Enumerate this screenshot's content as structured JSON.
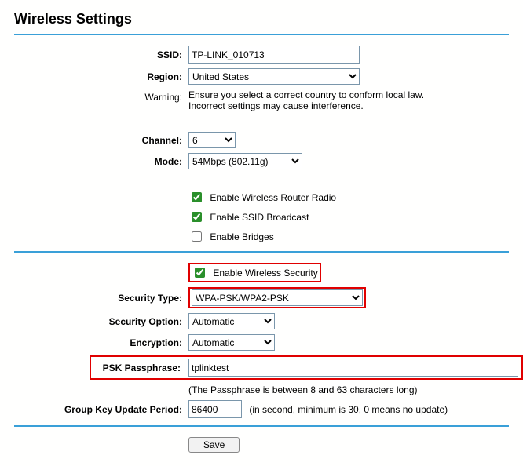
{
  "title": "Wireless Settings",
  "labels": {
    "ssid": "SSID:",
    "region": "Region:",
    "warning": "Warning:",
    "channel": "Channel:",
    "mode": "Mode:",
    "securityType": "Security Type:",
    "securityOption": "Security Option:",
    "encryption": "Encryption:",
    "pskPassphrase": "PSK Passphrase:",
    "groupKeyUpdate": "Group Key Update Period:"
  },
  "values": {
    "ssid": "TP-LINK_010713",
    "region": "United States",
    "channel": "6",
    "mode": "54Mbps (802.11g)",
    "securityType": "WPA-PSK/WPA2-PSK",
    "securityOption": "Automatic",
    "encryption": "Automatic",
    "pskPassphrase": "tplinktest",
    "groupKeyUpdate": "86400"
  },
  "warningText": "Ensure you select a correct country to conform local law. Incorrect settings may cause interference.",
  "checkboxes": {
    "enableRadio": "Enable Wireless Router Radio",
    "enableSsidBroadcast": "Enable SSID Broadcast",
    "enableBridges": "Enable Bridges",
    "enableSecurity": "Enable Wireless Security"
  },
  "notes": {
    "passphraseNote": "(The Passphrase is between 8 and 63 characters long)",
    "groupKeyNote": "(in second, minimum is 30, 0 means no update)"
  },
  "buttons": {
    "save": "Save"
  }
}
